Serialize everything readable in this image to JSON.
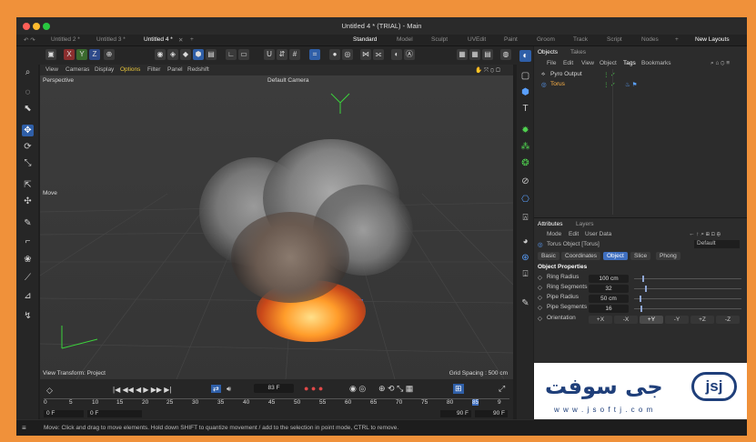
{
  "window": {
    "title": "Untitled 4 * (TRIAL) - Main",
    "traffic_lights": {
      "close": "#ff5f57",
      "minimize": "#febc2e",
      "zoom": "#28c840"
    }
  },
  "doc_tabs": [
    "Untitled 2 *",
    "Untitled 3 *",
    "Untitled 4 *"
  ],
  "layout_tabs": [
    "Standard",
    "Model",
    "Sculpt",
    "UVEdit",
    "Paint",
    "Groom",
    "Track",
    "Script",
    "Nodes"
  ],
  "new_layouts_label": "New Layouts",
  "axis_buttons": [
    "X",
    "Y",
    "Z"
  ],
  "viewport": {
    "menu": [
      "View",
      "Cameras",
      "Display",
      "Options",
      "Filter",
      "Panel",
      "Redshift"
    ],
    "label": "Perspective",
    "camera": "Default Camera",
    "move_label": "Move",
    "view_transform": "View Transform: Project",
    "grid_spacing": "Grid Spacing : 500 cm"
  },
  "timeline": {
    "current_frame": "83 F",
    "ruler": [
      "0",
      "5",
      "10",
      "15",
      "20",
      "25",
      "30",
      "35",
      "40",
      "45",
      "50",
      "55",
      "60",
      "65",
      "70",
      "75",
      "80",
      "85",
      "9"
    ],
    "start_a": "0 F",
    "start_b": "0 F",
    "end_a": "90 F",
    "end_b": "90 F"
  },
  "status": "Move: Click and drag to move elements. Hold down SHIFT to quantize movement / add to the selection in point mode, CTRL to remove.",
  "objects_panel": {
    "tabs": [
      "Objects",
      "Takes"
    ],
    "menu": [
      "File",
      "Edit",
      "View",
      "Object",
      "Tags",
      "Bookmarks"
    ],
    "rows": [
      {
        "name": "Pyro Output",
        "color": "#d6d6d6"
      },
      {
        "name": "Torus",
        "color": "#ffb347"
      }
    ]
  },
  "attributes_panel": {
    "tabs": [
      "Attributes",
      "Layers"
    ],
    "menu": [
      "Mode",
      "Edit",
      "User Data"
    ],
    "object_name": "Torus Object [Torus]",
    "dropdown": "Default",
    "subtabs": [
      "Basic",
      "Coordinates",
      "Object",
      "Slice",
      "Phong"
    ],
    "active_subtab": "Object",
    "section": "Object Properties",
    "props": [
      {
        "label": "Ring Radius",
        "value": "100 cm",
        "level": 0.08
      },
      {
        "label": "Ring Segments",
        "value": "32",
        "level": 0.1
      },
      {
        "label": "Pipe Radius",
        "value": "50 cm",
        "level": 0.05
      },
      {
        "label": "Pipe Segments",
        "value": "16",
        "level": 0.06
      }
    ],
    "orientation_label": "Orientation",
    "orientation_options": [
      "+X",
      "-X",
      "+Y",
      "-Y",
      "+Z",
      "-Z"
    ],
    "orientation_selected": "+Y"
  },
  "watermark": {
    "brand": "جی سوفت",
    "url": "w w w . j s o f t j . c o m",
    "mark": "jsj"
  }
}
